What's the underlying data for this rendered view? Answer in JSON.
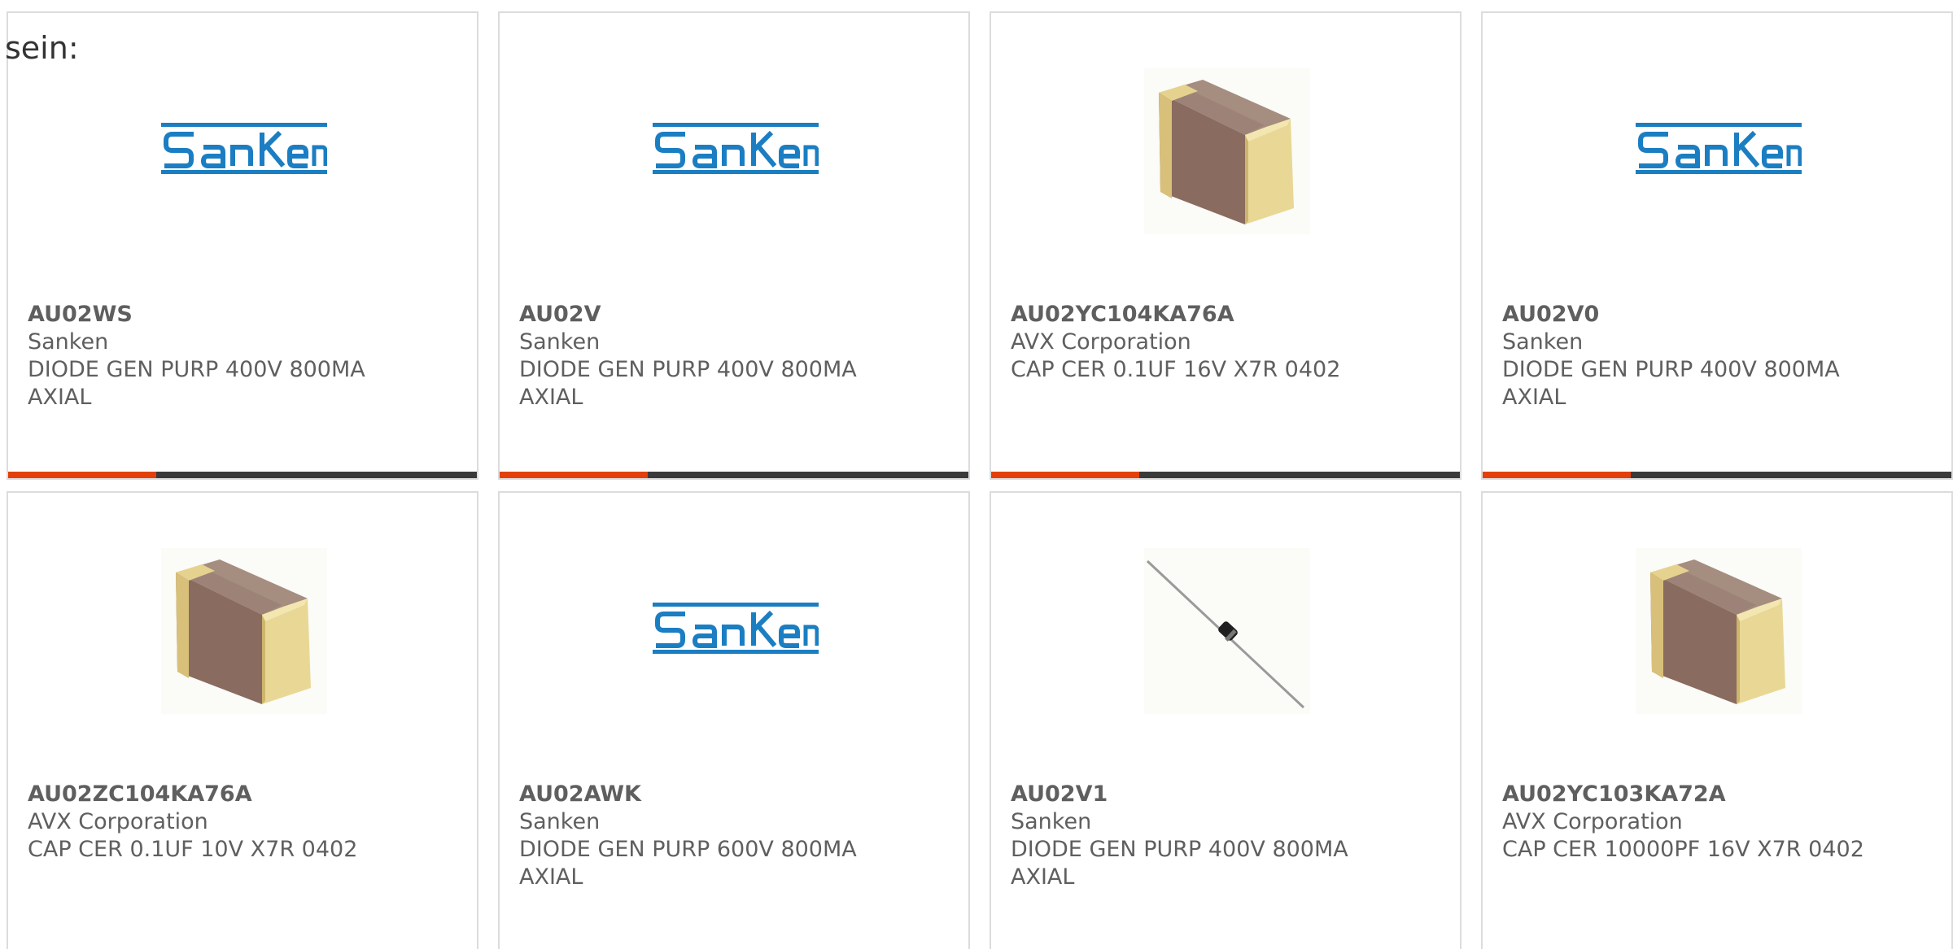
{
  "intro_text": "sein:",
  "colors": {
    "accent_bar": "#e3400c",
    "bar_dark": "#3a3a3a",
    "sanken_blue": "#1b7ec2"
  },
  "cards": [
    {
      "part": "AU02WS",
      "manufacturer": "Sanken",
      "desc1": "DIODE GEN PURP 400V 800MA",
      "desc2": "AXIAL",
      "image": "sanken-logo"
    },
    {
      "part": "AU02V",
      "manufacturer": "Sanken",
      "desc1": "DIODE GEN PURP 400V 800MA",
      "desc2": "AXIAL",
      "image": "sanken-logo"
    },
    {
      "part": "AU02YC104KA76A",
      "manufacturer": "AVX Corporation",
      "desc1": "CAP CER 0.1UF 16V X7R 0402",
      "desc2": "",
      "image": "ceramic-capacitor"
    },
    {
      "part": "AU02V0",
      "manufacturer": "Sanken",
      "desc1": "DIODE GEN PURP 400V 800MA",
      "desc2": "AXIAL",
      "image": "sanken-logo"
    },
    {
      "part": "AU02ZC104KA76A",
      "manufacturer": "AVX Corporation",
      "desc1": "CAP CER 0.1UF 10V X7R 0402",
      "desc2": "",
      "image": "ceramic-capacitor"
    },
    {
      "part": "AU02AWK",
      "manufacturer": "Sanken",
      "desc1": "DIODE GEN PURP 600V 800MA",
      "desc2": "AXIAL",
      "image": "sanken-logo"
    },
    {
      "part": "AU02V1",
      "manufacturer": "Sanken",
      "desc1": "DIODE GEN PURP 400V 800MA",
      "desc2": "AXIAL",
      "image": "axial-diode"
    },
    {
      "part": "AU02YC103KA72A",
      "manufacturer": "AVX Corporation",
      "desc1": "CAP CER 10000PF 16V X7R 0402",
      "desc2": "",
      "image": "ceramic-capacitor"
    }
  ]
}
